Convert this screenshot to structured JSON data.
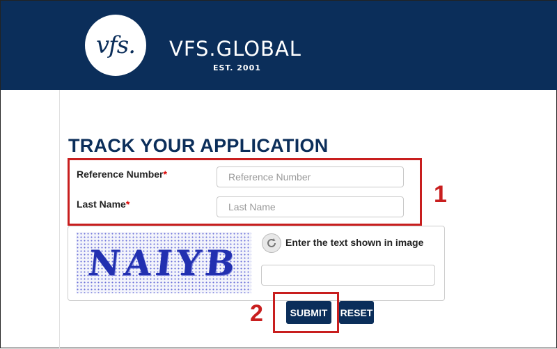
{
  "header": {
    "logo_text": "vfs.",
    "brand": "VFS.GLOBAL",
    "est": "EST. 2001",
    "bg_color": "#0b2e5a"
  },
  "form": {
    "title": "TRACK YOUR APPLICATION",
    "reference_label": "Reference Number",
    "reference_placeholder": "Reference Number",
    "lastname_label": "Last Name",
    "lastname_placeholder": "Last Name",
    "required_mark": "*"
  },
  "captcha": {
    "image_text": "NAIYB",
    "prompt": "Enter the text shown in image",
    "refresh_icon": "refresh-icon"
  },
  "buttons": {
    "submit": "SUBMIT",
    "reset": "RESET"
  },
  "annotations": {
    "step1": "1",
    "step2": "2",
    "color": "#c81e1e"
  }
}
